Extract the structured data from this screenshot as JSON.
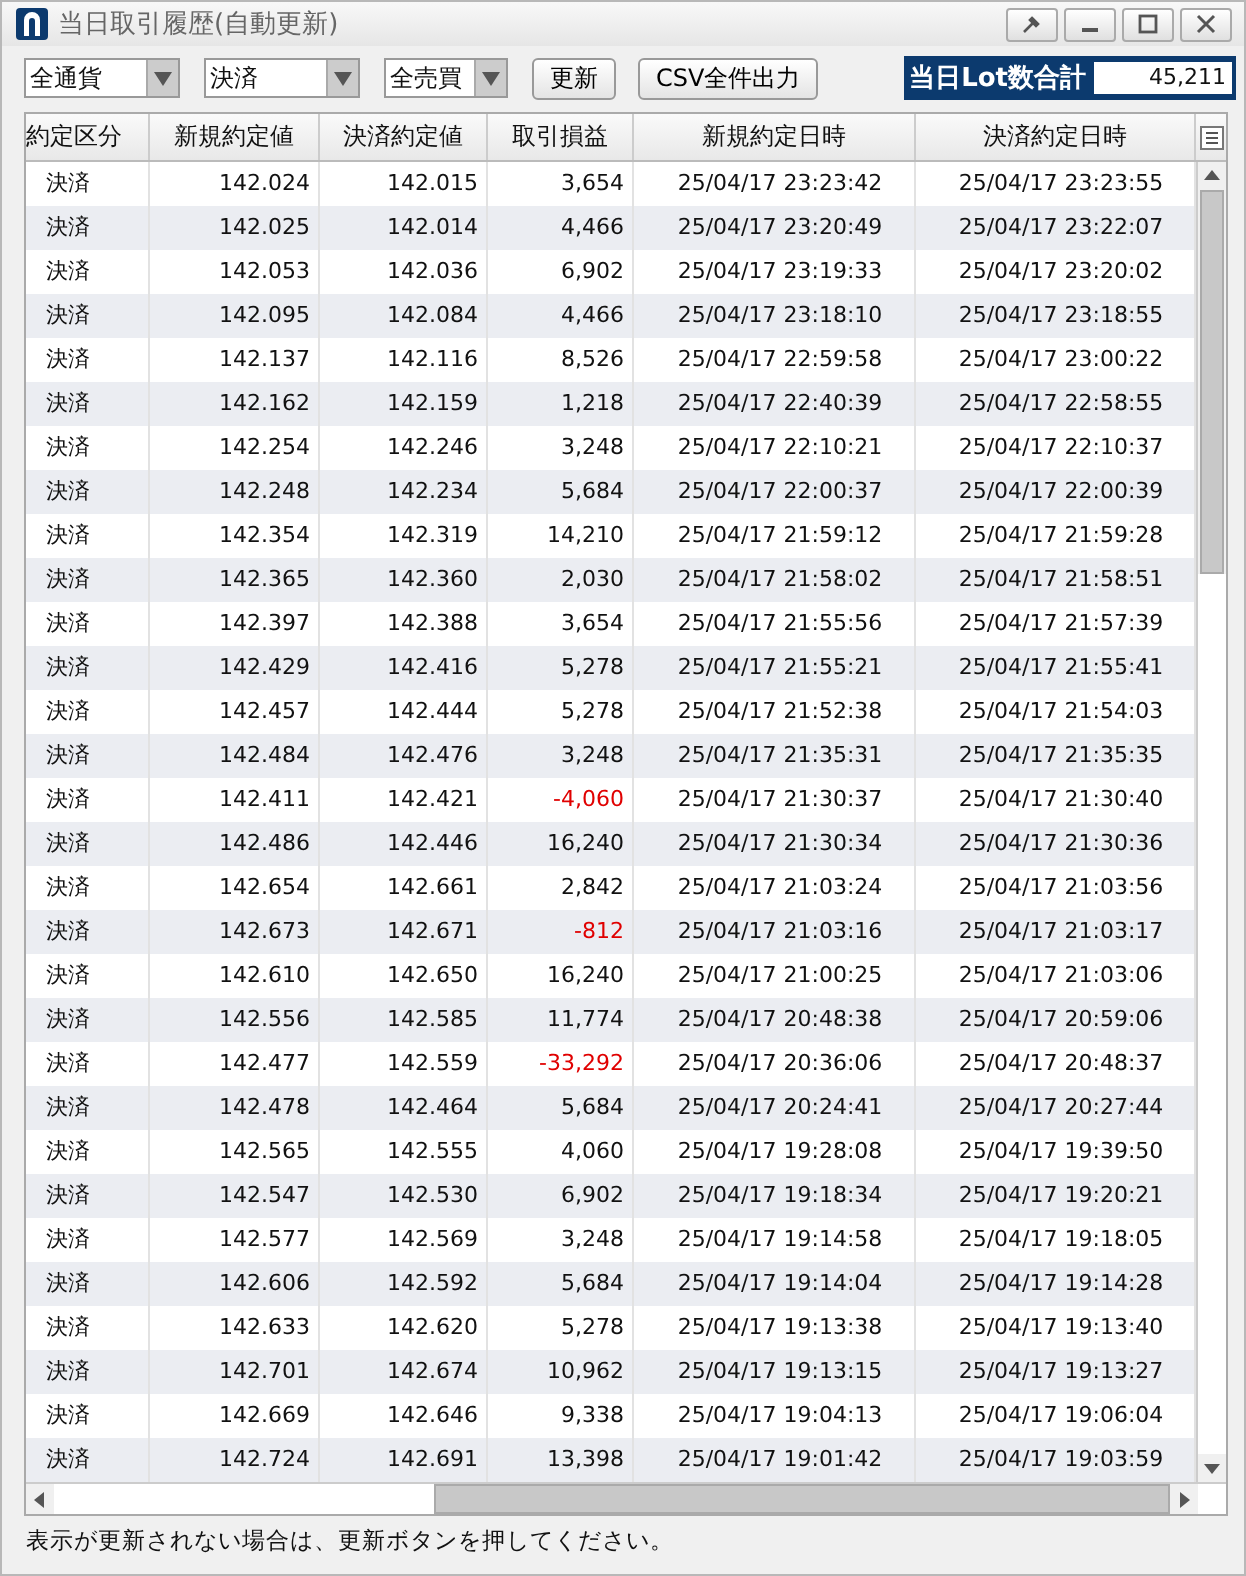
{
  "window": {
    "title": "当日取引履歴(自動更新)"
  },
  "filters": [
    {
      "value": "全通貨"
    },
    {
      "value": "決済"
    },
    {
      "value": "全売買"
    }
  ],
  "buttons": [
    "更新",
    "CSV全件出力"
  ],
  "lot_total": {
    "label": "当日Lot数合計",
    "value": "45,211"
  },
  "table": {
    "columns": [
      "約定区分",
      "新規約定値",
      "決済約定値",
      "取引損益",
      "新規約定日時",
      "決済約定日時"
    ],
    "rows": [
      {
        "cells": [
          "決済",
          "142.024",
          "142.015",
          "3,654",
          "25/04/17 23:23:42",
          "25/04/17 23:23:55"
        ],
        "loss": false
      },
      {
        "cells": [
          "決済",
          "142.025",
          "142.014",
          "4,466",
          "25/04/17 23:20:49",
          "25/04/17 23:22:07"
        ],
        "loss": false
      },
      {
        "cells": [
          "決済",
          "142.053",
          "142.036",
          "6,902",
          "25/04/17 23:19:33",
          "25/04/17 23:20:02"
        ],
        "loss": false
      },
      {
        "cells": [
          "決済",
          "142.095",
          "142.084",
          "4,466",
          "25/04/17 23:18:10",
          "25/04/17 23:18:55"
        ],
        "loss": false
      },
      {
        "cells": [
          "決済",
          "142.137",
          "142.116",
          "8,526",
          "25/04/17 22:59:58",
          "25/04/17 23:00:22"
        ],
        "loss": false
      },
      {
        "cells": [
          "決済",
          "142.162",
          "142.159",
          "1,218",
          "25/04/17 22:40:39",
          "25/04/17 22:58:55"
        ],
        "loss": false
      },
      {
        "cells": [
          "決済",
          "142.254",
          "142.246",
          "3,248",
          "25/04/17 22:10:21",
          "25/04/17 22:10:37"
        ],
        "loss": false
      },
      {
        "cells": [
          "決済",
          "142.248",
          "142.234",
          "5,684",
          "25/04/17 22:00:37",
          "25/04/17 22:00:39"
        ],
        "loss": false
      },
      {
        "cells": [
          "決済",
          "142.354",
          "142.319",
          "14,210",
          "25/04/17 21:59:12",
          "25/04/17 21:59:28"
        ],
        "loss": false
      },
      {
        "cells": [
          "決済",
          "142.365",
          "142.360",
          "2,030",
          "25/04/17 21:58:02",
          "25/04/17 21:58:51"
        ],
        "loss": false
      },
      {
        "cells": [
          "決済",
          "142.397",
          "142.388",
          "3,654",
          "25/04/17 21:55:56",
          "25/04/17 21:57:39"
        ],
        "loss": false
      },
      {
        "cells": [
          "決済",
          "142.429",
          "142.416",
          "5,278",
          "25/04/17 21:55:21",
          "25/04/17 21:55:41"
        ],
        "loss": false
      },
      {
        "cells": [
          "決済",
          "142.457",
          "142.444",
          "5,278",
          "25/04/17 21:52:38",
          "25/04/17 21:54:03"
        ],
        "loss": false
      },
      {
        "cells": [
          "決済",
          "142.484",
          "142.476",
          "3,248",
          "25/04/17 21:35:31",
          "25/04/17 21:35:35"
        ],
        "loss": false
      },
      {
        "cells": [
          "決済",
          "142.411",
          "142.421",
          "-4,060",
          "25/04/17 21:30:37",
          "25/04/17 21:30:40"
        ],
        "loss": true
      },
      {
        "cells": [
          "決済",
          "142.486",
          "142.446",
          "16,240",
          "25/04/17 21:30:34",
          "25/04/17 21:30:36"
        ],
        "loss": false
      },
      {
        "cells": [
          "決済",
          "142.654",
          "142.661",
          "2,842",
          "25/04/17 21:03:24",
          "25/04/17 21:03:56"
        ],
        "loss": false
      },
      {
        "cells": [
          "決済",
          "142.673",
          "142.671",
          "-812",
          "25/04/17 21:03:16",
          "25/04/17 21:03:17"
        ],
        "loss": true
      },
      {
        "cells": [
          "決済",
          "142.610",
          "142.650",
          "16,240",
          "25/04/17 21:00:25",
          "25/04/17 21:03:06"
        ],
        "loss": false
      },
      {
        "cells": [
          "決済",
          "142.556",
          "142.585",
          "11,774",
          "25/04/17 20:48:38",
          "25/04/17 20:59:06"
        ],
        "loss": false
      },
      {
        "cells": [
          "決済",
          "142.477",
          "142.559",
          "-33,292",
          "25/04/17 20:36:06",
          "25/04/17 20:48:37"
        ],
        "loss": true
      },
      {
        "cells": [
          "決済",
          "142.478",
          "142.464",
          "5,684",
          "25/04/17 20:24:41",
          "25/04/17 20:27:44"
        ],
        "loss": false
      },
      {
        "cells": [
          "決済",
          "142.565",
          "142.555",
          "4,060",
          "25/04/17 19:28:08",
          "25/04/17 19:39:50"
        ],
        "loss": false
      },
      {
        "cells": [
          "決済",
          "142.547",
          "142.530",
          "6,902",
          "25/04/17 19:18:34",
          "25/04/17 19:20:21"
        ],
        "loss": false
      },
      {
        "cells": [
          "決済",
          "142.577",
          "142.569",
          "3,248",
          "25/04/17 19:14:58",
          "25/04/17 19:18:05"
        ],
        "loss": false
      },
      {
        "cells": [
          "決済",
          "142.606",
          "142.592",
          "5,684",
          "25/04/17 19:14:04",
          "25/04/17 19:14:28"
        ],
        "loss": false
      },
      {
        "cells": [
          "決済",
          "142.633",
          "142.620",
          "5,278",
          "25/04/17 19:13:38",
          "25/04/17 19:13:40"
        ],
        "loss": false
      },
      {
        "cells": [
          "決済",
          "142.701",
          "142.674",
          "10,962",
          "25/04/17 19:13:15",
          "25/04/17 19:13:27"
        ],
        "loss": false
      },
      {
        "cells": [
          "決済",
          "142.669",
          "142.646",
          "9,338",
          "25/04/17 19:04:13",
          "25/04/17 19:06:04"
        ],
        "loss": false
      },
      {
        "cells": [
          "決済",
          "142.724",
          "142.691",
          "13,398",
          "25/04/17 19:01:42",
          "25/04/17 19:03:59"
        ],
        "loss": false
      }
    ]
  },
  "status_bar": "表示が更新されない場合は、更新ボタンを押してください。"
}
